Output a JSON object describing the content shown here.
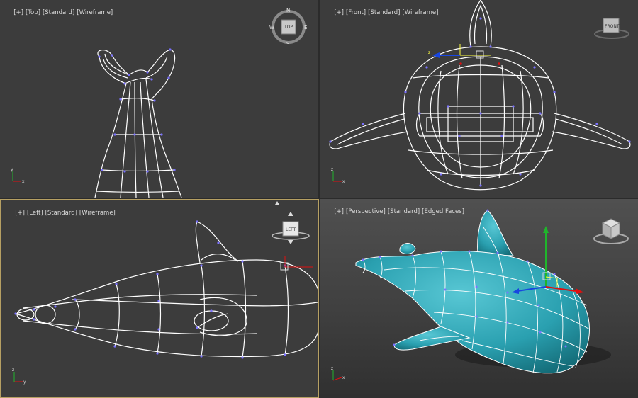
{
  "viewports": [
    {
      "id": "top",
      "labels": [
        "[+]",
        "[Top]",
        "[Standard]",
        "[Wireframe]"
      ],
      "viewcube": "TOP",
      "compass": [
        "N",
        "E",
        "S",
        "W"
      ]
    },
    {
      "id": "front",
      "labels": [
        "[+]",
        "[Front]",
        "[Standard]",
        "[Wireframe]"
      ],
      "viewcube": "FRONT"
    },
    {
      "id": "left",
      "labels": [
        "[+]",
        "[Left]",
        "[Standard]",
        "[Wireframe]"
      ],
      "viewcube": "LEFT",
      "active": true
    },
    {
      "id": "perspective",
      "labels": [
        "[+]",
        "[Perspective]",
        "[Standard]",
        "[Edged Faces]"
      ]
    }
  ],
  "axes": {
    "x": "x",
    "y": "y",
    "z": "z"
  },
  "colors": {
    "viewport_bg": "#3c3c3c",
    "active_border": "#b6a063",
    "wire": "#ffffff",
    "vertex": "#7b72ff",
    "model_fill": "#2aa0b0",
    "axis_x": "#e01010",
    "axis_y": "#1fb52b",
    "axis_z": "#1846e0"
  }
}
